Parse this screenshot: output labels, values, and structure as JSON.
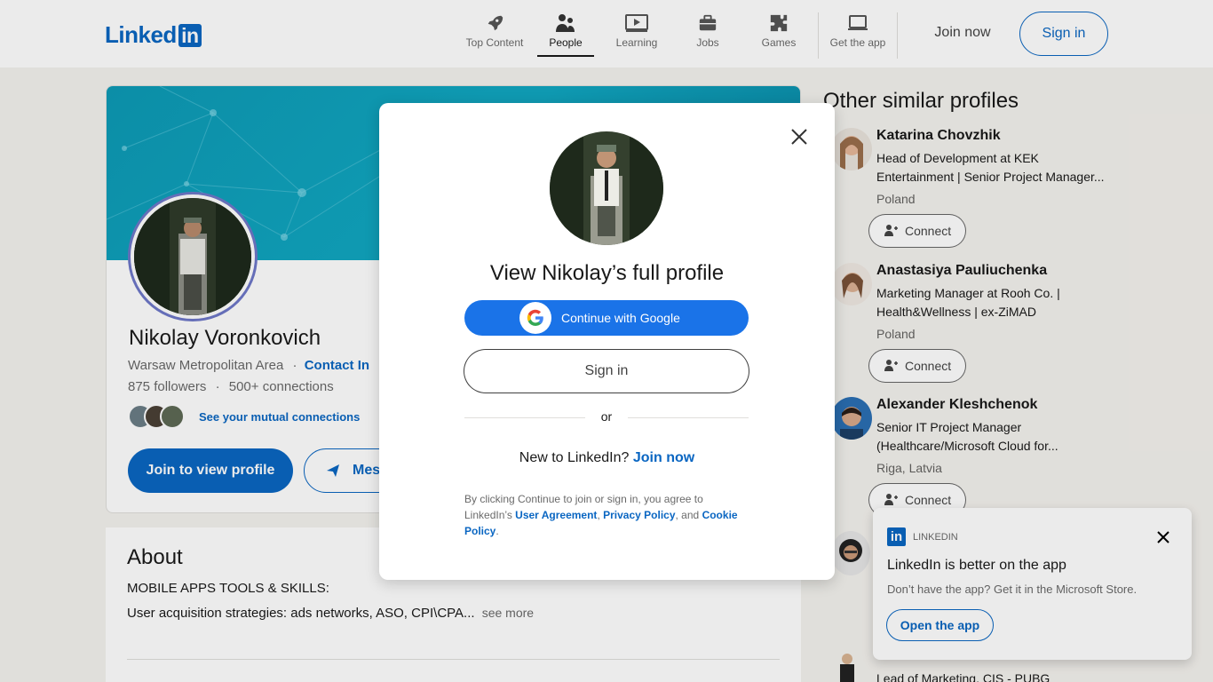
{
  "brand": {
    "logo_text": "Linked",
    "logo_box": "in",
    "accent": "#0a66c2"
  },
  "nav": {
    "items": [
      {
        "label": "Top Content",
        "icon": "rocket-icon"
      },
      {
        "label": "People",
        "icon": "people-icon"
      },
      {
        "label": "Learning",
        "icon": "learning-icon"
      },
      {
        "label": "Jobs",
        "icon": "briefcase-icon"
      },
      {
        "label": "Games",
        "icon": "puzzle-icon"
      },
      {
        "label": "Get the app",
        "icon": "laptop-icon"
      }
    ],
    "active": "People",
    "join_label": "Join now",
    "signin_label": "Sign in"
  },
  "profile": {
    "name": "Nikolay Voronkovich",
    "location": "Warsaw Metropolitan Area",
    "separator": "·",
    "contact": "Contact In",
    "followers": "875 followers",
    "connections": "500+ connections",
    "mutual": "See your mutual connections",
    "join_button": "Join to view profile",
    "message_button": "Mess"
  },
  "about": {
    "title": "About",
    "line1": "MOBILE APPS TOOLS & SKILLS:",
    "line2": "User acquisition strategies: ads networks, ASO, CPI\\CPA...",
    "see_more": "see more"
  },
  "sidebar": {
    "title": "Other similar profiles",
    "connect_label": "Connect",
    "people": [
      {
        "name": "Katarina Chovzhik",
        "headline1": "Head of Development at KEK",
        "headline2": "Entertainment | Senior Project Manager...",
        "location": "Poland"
      },
      {
        "name": "Anastasiya Pauliuchenka",
        "headline1": "Marketing Manager at Rooh Co. |",
        "headline2": "Health&Wellness | ex-ZiMAD",
        "location": "Poland"
      },
      {
        "name": "Alexander Kleshchenok",
        "headline1": "Senior IT Project Manager",
        "headline2": "(Healthcare/Microsoft Cloud for...",
        "location": "Riga, Latvia"
      }
    ],
    "bottom_headline": "Lead of Marketing, CIS - PUBG"
  },
  "modal": {
    "title": "View Nikolay’s full profile",
    "google_label": "Continue with Google",
    "signin_label": "Sign in",
    "or": "or",
    "new_prefix": "New to LinkedIn?",
    "join_label": "Join now",
    "legal_prefix": "By clicking Continue to join or sign in, you agree to LinkedIn’s",
    "user_agreement": "User Agreement",
    "comma": ",",
    "privacy": "Privacy Policy",
    "and": ", and",
    "cookie": "Cookie Policy",
    "period": "."
  },
  "toast": {
    "brand": "LINKEDIN",
    "title": "LinkedIn is better on the app",
    "subtitle": "Don’t have the app? Get it in the Microsoft Store.",
    "button": "Open the app"
  }
}
